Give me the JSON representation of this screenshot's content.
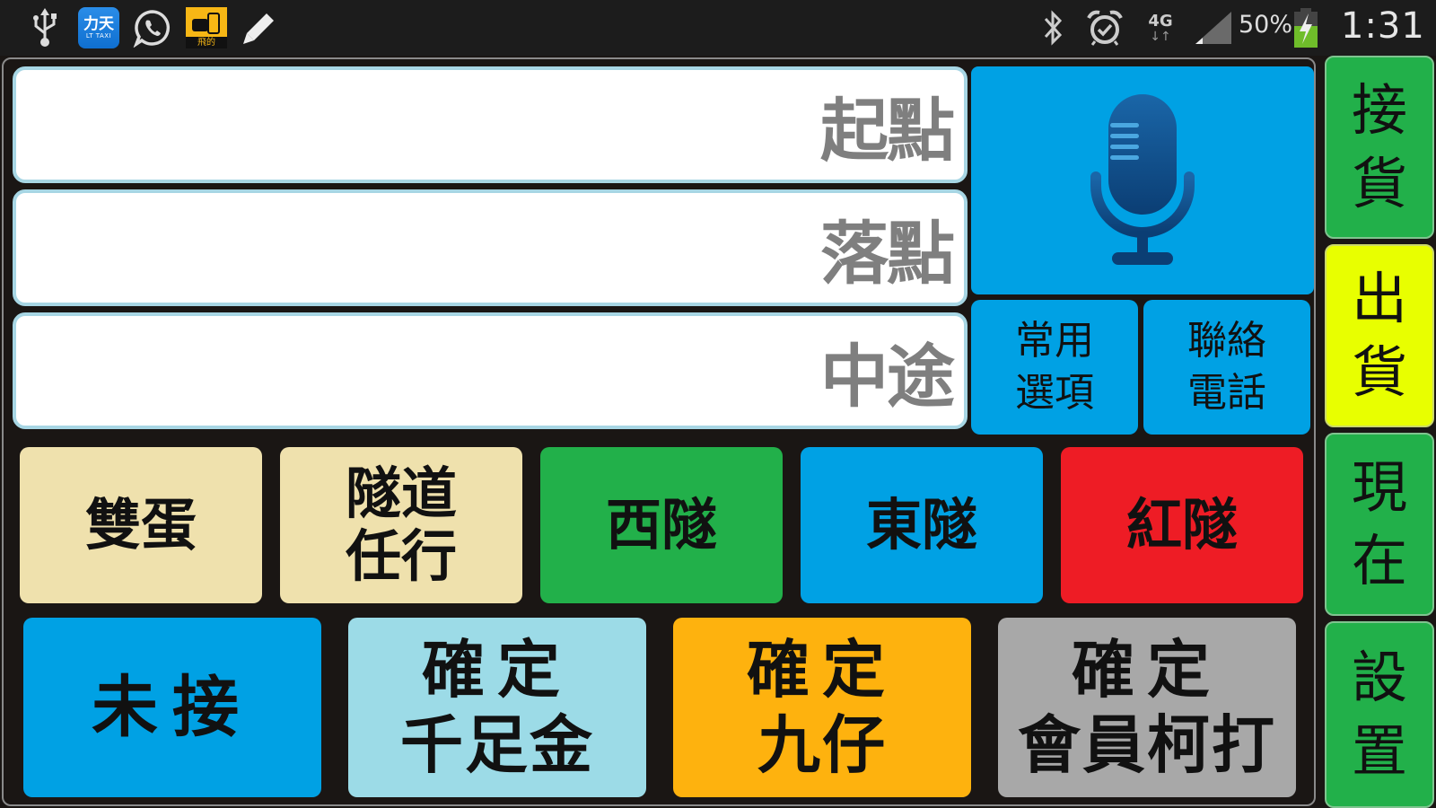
{
  "status_bar": {
    "left_icons": [
      "usb-icon",
      "lt-taxi-app-icon",
      "whatsapp-icon",
      "feidi-app-icon",
      "pencil-icon"
    ],
    "lt_taxi": {
      "cn": "力天",
      "en": "LT TAXI"
    },
    "feidi_label": "飛的",
    "right_icons": [
      "bluetooth-icon",
      "alarm-icon",
      "network-4g-icon",
      "signal-icon",
      "battery-charging-icon"
    ],
    "network": {
      "type": "4G",
      "arrows": "↓↑"
    },
    "battery_percent": "50%",
    "time": "1:31"
  },
  "fields": [
    {
      "label": "起點",
      "value": ""
    },
    {
      "label": "落點",
      "value": ""
    },
    {
      "label": "中途",
      "value": ""
    }
  ],
  "mic_button": {
    "icon": "microphone-icon"
  },
  "small_buttons": [
    {
      "line1": "常用",
      "line2": "選項"
    },
    {
      "line1": "聯絡",
      "line2": "電話"
    }
  ],
  "row1_buttons": [
    {
      "line1": "雙蛋",
      "line2": "",
      "color": "#efe1ad"
    },
    {
      "line1": "隧道",
      "line2": "任行",
      "color": "#efe1ad"
    },
    {
      "line1": "西隧",
      "line2": "",
      "color": "#22b04a"
    },
    {
      "line1": "東隧",
      "line2": "",
      "color": "#00a1e4"
    },
    {
      "line1": "紅隧",
      "line2": "",
      "color": "#ee1c25"
    }
  ],
  "row2_buttons": [
    {
      "line1": "未接",
      "line2": "",
      "color": "#00a1e4"
    },
    {
      "line1": "確定",
      "line2": "千足金",
      "color": "#9cdbe7"
    },
    {
      "line1": "確定",
      "line2": "九仔",
      "color": "#feb20e"
    },
    {
      "line1": "確定",
      "line2": "會員柯打",
      "color": "#a8a8a8"
    }
  ],
  "side_buttons": [
    {
      "line1": "接",
      "line2": "貨",
      "color": "#22b04a"
    },
    {
      "line1": "出",
      "line2": "貨",
      "color": "#e8ff00"
    },
    {
      "line1": "現",
      "line2": "在",
      "color": "#22b04a"
    },
    {
      "line1": "設",
      "line2": "置",
      "color": "#22b04a"
    }
  ]
}
